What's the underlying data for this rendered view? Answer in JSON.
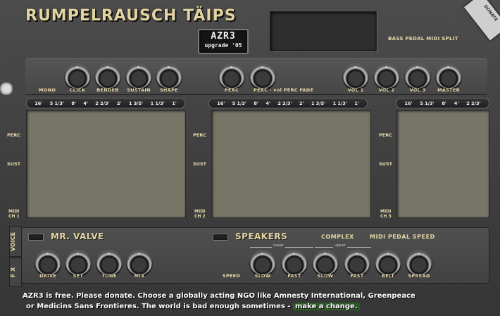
{
  "header": {
    "title": "RUMPELRAUSCH TÄIPS",
    "logo_line1": "AZR3",
    "logo_line2": "upgrade '05",
    "bass_pedal_label": "BASS PEDAL MIDI SPLIT",
    "corner_tag": "DONATE"
  },
  "top_knobs": [
    {
      "label": "MONO"
    },
    {
      "label": "CLICK"
    },
    {
      "label": "BENDER"
    },
    {
      "label": "SUSTAIN"
    },
    {
      "label": "SHAPE"
    },
    {
      "label": "PERC"
    },
    {
      "label": "PERC - vol PERC FADE"
    },
    {
      "label": "VOL 1"
    },
    {
      "label": "VOL 2"
    },
    {
      "label": "VOL 3"
    },
    {
      "label": "MASTER"
    }
  ],
  "drawbars": {
    "footages_full": [
      "16'",
      "5 1/3'",
      "8'",
      "4'",
      "2 2/3'",
      "2'",
      "1 3/5'",
      "1 1/3'",
      "1'"
    ],
    "footages_short": [
      "16'",
      "5 1/3'",
      "8'",
      "4'",
      "2 2/3'"
    ],
    "row_perc": "PERC",
    "row_sust": "SUST",
    "midi": [
      "MIDI CH 1",
      "MIDI CH 2",
      "MIDI CH 3"
    ]
  },
  "fx": {
    "tab_voice": "VOICE",
    "tab_fx": "F X",
    "valve_title": "MR. VALVE",
    "speakers_title": "SPEAKERS",
    "complex_label": "COMPLEX",
    "midi_pedal_speed": "MIDI PEDAL SPEED",
    "lower": "lower",
    "upper": "upper",
    "speed_label": "SPEED",
    "valve_knobs": [
      "DRIVE",
      "SET",
      "TONE",
      "MIX"
    ],
    "speaker_knobs": [
      "SLOW",
      "FAST",
      "SLOW",
      "FAST",
      "BELT",
      "SPREAD"
    ]
  },
  "footer": {
    "line1": "AZR3 is free. Please donate. Choose a globally acting NGO like Amnesty International, Greenpeace",
    "line2": "or Medicins Sans Frontieres. The world is bad enough sometimes -",
    "link": "make a change."
  }
}
